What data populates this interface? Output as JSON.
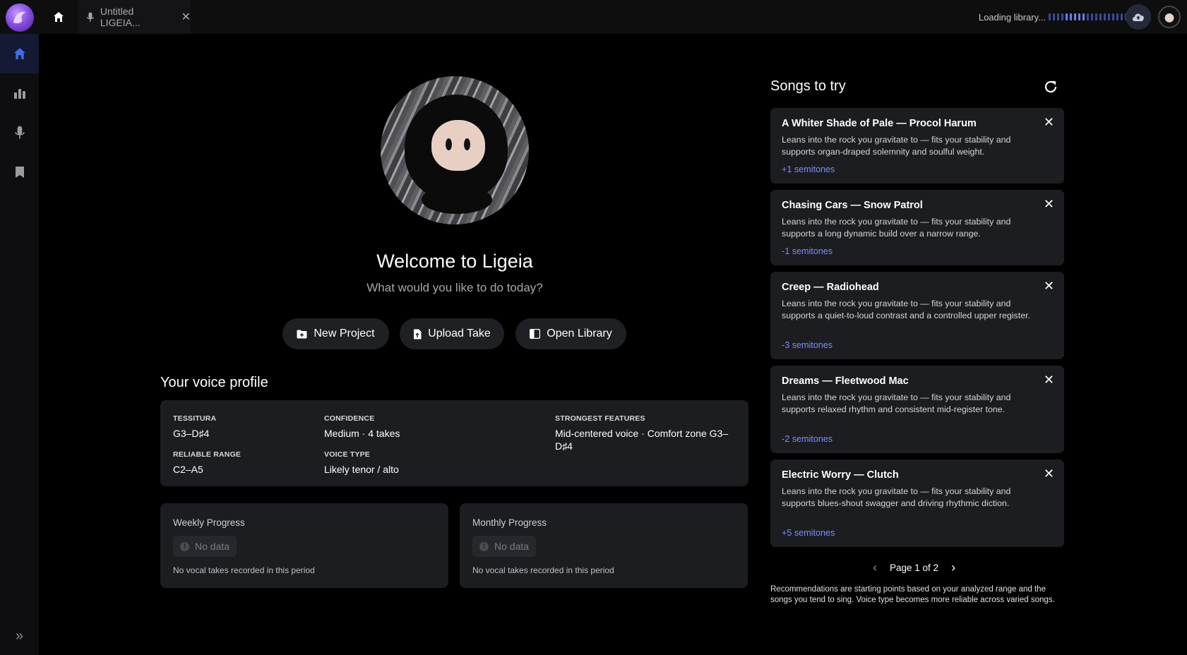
{
  "topbar": {
    "tab_title": "Untitled LIGEIA...",
    "loading_text": "Loading library..."
  },
  "welcome": {
    "title": "Welcome to Ligeia",
    "subtitle": "What would you like to do today?"
  },
  "actions": [
    {
      "label": "New Project",
      "icon": "folder-plus-icon"
    },
    {
      "label": "Upload Take",
      "icon": "file-upload-icon"
    },
    {
      "label": "Open Library",
      "icon": "library-icon"
    }
  ],
  "voice_profile": {
    "title": "Your voice profile",
    "tessitura_label": "TESSITURA",
    "tessitura": "G3–D♯4",
    "confidence_label": "CONFIDENCE",
    "confidence": "Medium · 4 takes",
    "strongest_label": "STRONGEST FEATURES",
    "strongest": "Mid-centered voice · Comfort zone G3–D♯4",
    "reliable_label": "RELIABLE RANGE",
    "reliable": "C2–A5",
    "voice_type_label": "VOICE TYPE",
    "voice_type": "Likely tenor / alto"
  },
  "progress": {
    "weekly_title": "Weekly Progress",
    "monthly_title": "Monthly Progress",
    "no_data": "No data",
    "note": "No vocal takes recorded in this period"
  },
  "songs": {
    "title": "Songs to try",
    "items": [
      {
        "title": "A Whiter Shade of Pale — Procol Harum",
        "desc": "Leans into the rock you gravitate to — fits your stability and supports organ-draped solemnity and soulful weight.",
        "semitones": "+1 semitones"
      },
      {
        "title": "Chasing Cars — Snow Patrol",
        "desc": "Leans into the rock you gravitate to — fits your stability and supports a long dynamic build over a narrow range.",
        "semitones": "-1 semitones"
      },
      {
        "title": "Creep — Radiohead",
        "desc": "Leans into the rock you gravitate to — fits your stability and supports a quiet-to-loud contrast and a controlled upper register.",
        "semitones": "-3 semitones"
      },
      {
        "title": "Dreams — Fleetwood Mac",
        "desc": "Leans into the rock you gravitate to — fits your stability and supports relaxed rhythm and consistent mid-register tone.",
        "semitones": "-2 semitones"
      },
      {
        "title": "Electric Worry — Clutch",
        "desc": "Leans into the rock you gravitate to — fits your stability and supports blues-shout swagger and driving rhythmic diction.",
        "semitones": "+5 semitones"
      }
    ],
    "pager": "Page 1 of 2",
    "disclaimer": "Recommendations are starting points based on your analyzed range and the songs you tend to sing. Voice type becomes more reliable across varied songs."
  },
  "colors": {
    "accent": "#7d8cff",
    "card_bg": "#1c1d20",
    "active_nav": "#2f5bd6"
  }
}
